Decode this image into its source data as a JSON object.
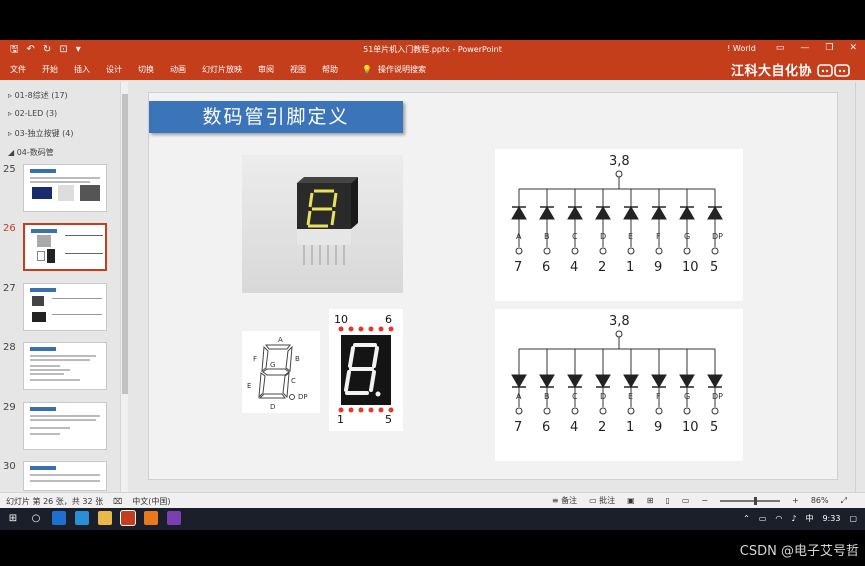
{
  "titlebar": {
    "doc_title": "51单片机入门教程.pptx  -  PowerPoint",
    "account": "! World"
  },
  "ribbon": {
    "tabs": [
      "文件",
      "开始",
      "插入",
      "设计",
      "切换",
      "动画",
      "幻灯片放映",
      "审阅",
      "视图",
      "帮助"
    ],
    "tell_me": "操作说明搜索",
    "watermark": "江科大自化协"
  },
  "thumbnails": {
    "sections": [
      "01-8综述 (17)",
      "02-LED (3)",
      "03-独立按键 (4)",
      "04-数码管"
    ],
    "slides": [
      "25",
      "26",
      "27",
      "28",
      "29",
      "30"
    ],
    "active": "26"
  },
  "slide": {
    "title": "数码管引脚定义",
    "segment_letters": [
      "A",
      "F",
      "B",
      "G",
      "E",
      "C",
      "D",
      "DP"
    ],
    "photo_pins_top": [
      "10",
      "6"
    ],
    "photo_pins_bottom": [
      "1",
      "5"
    ],
    "common_label": "3,8",
    "diode_labels": [
      "A",
      "B",
      "C",
      "D",
      "E",
      "F",
      "G",
      "DP"
    ],
    "pin_numbers": [
      "7",
      "6",
      "4",
      "2",
      "1",
      "9",
      "10",
      "5"
    ],
    "led_color": "#e23a2a",
    "title_color": "#3b74b9"
  },
  "statusbar": {
    "slide_info": "幻灯片 第 26 张，共 32 张",
    "language": "中文(中国)",
    "notes": "备注",
    "comments": "批注",
    "zoom": "86%"
  },
  "taskbar": {
    "ime": "中",
    "time": "9:33"
  },
  "overlay": {
    "csdn": "CSDN @电子艾号哲"
  }
}
